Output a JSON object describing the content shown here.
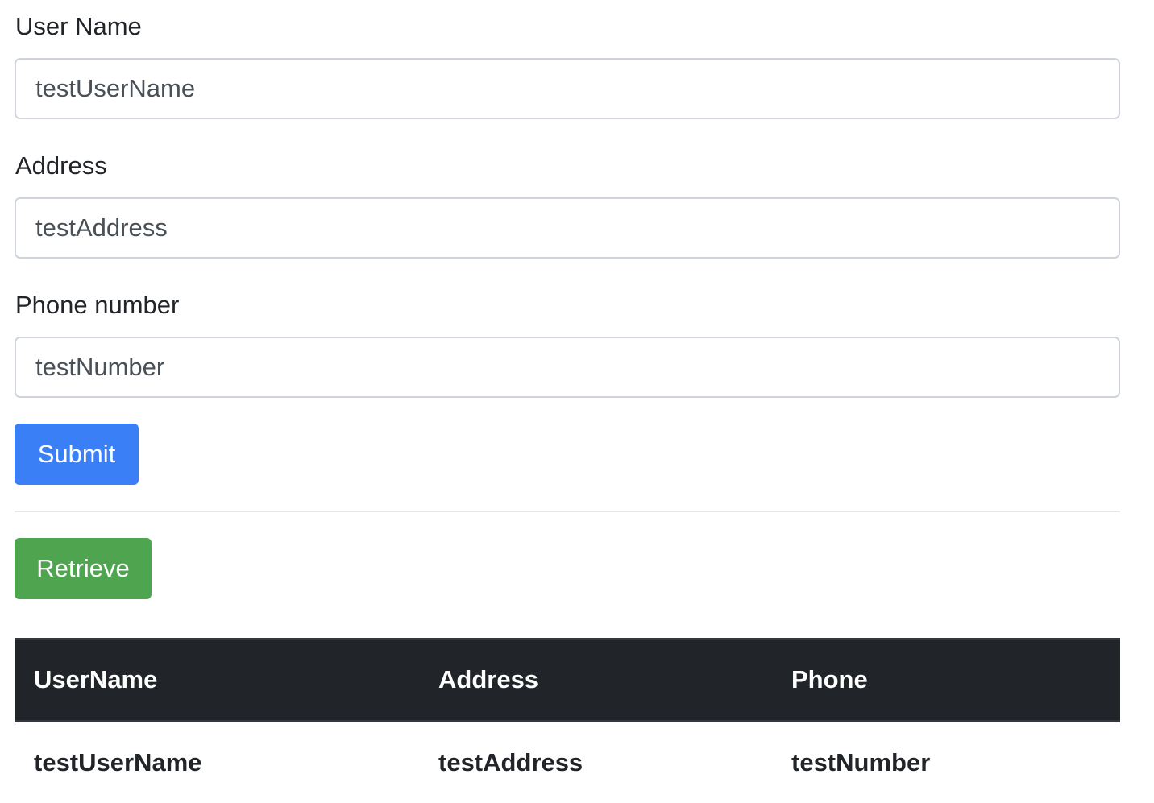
{
  "form": {
    "username": {
      "label": "User Name",
      "value": "testUserName"
    },
    "address": {
      "label": "Address",
      "value": "testAddress"
    },
    "phone": {
      "label": "Phone number",
      "value": "testNumber"
    },
    "submit_label": "Submit"
  },
  "retrieve_label": "Retrieve",
  "table": {
    "headers": [
      "UserName",
      "Address",
      "Phone"
    ],
    "rows": [
      [
        "testUserName",
        "testAddress",
        "testNumber"
      ]
    ]
  },
  "colors": {
    "primary": "#3b7ff6",
    "success": "#4fa54f",
    "table_header_bg": "#212529"
  }
}
